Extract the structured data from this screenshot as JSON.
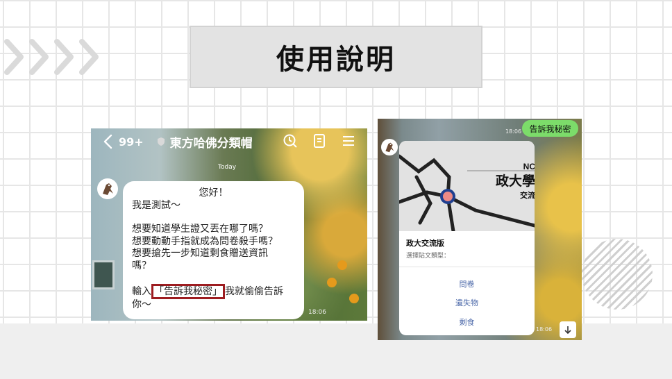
{
  "title": "使用說明",
  "left_chat": {
    "badge": "99+",
    "chat_name": "東方哈佛分類帽",
    "today_label": "Today",
    "message": {
      "line1": "您好！",
      "line2": "我是測試～",
      "line3": "想要知道學生證又丟在哪了嗎？",
      "line4": "想要動動手指就成為問卷殺手嗎？",
      "line5": "想要搶先一步知道剩食贈送資訊",
      "line6": "嗎？",
      "line7_prefix": "輸入",
      "keyword": "「告訴我秘密」",
      "line7_suffix": "我就偷偷告訴",
      "line8": "你～"
    },
    "time": "18:06"
  },
  "right_chat": {
    "sent_pill": "告訴我秘密",
    "sent_time": "18:06",
    "map_labels": {
      "nc": "NC",
      "univ": "政大學",
      "jiao": "交流"
    },
    "card_title": "政大交流版",
    "card_subtitle": "選擇貼文類型：",
    "options": [
      "問卷",
      "遺失物",
      "剩食"
    ],
    "card_time": "18:06"
  },
  "icons": [
    "chevron-left-icon",
    "shield-icon",
    "clock-icon",
    "notes-icon",
    "menu-icon",
    "arrow-down-icon"
  ],
  "colors": {
    "highlight_border": "#9d1c20",
    "sent_bubble": "#7cdc6a",
    "option_text": "#4a67a8",
    "title_box": "#e3e3e3"
  }
}
